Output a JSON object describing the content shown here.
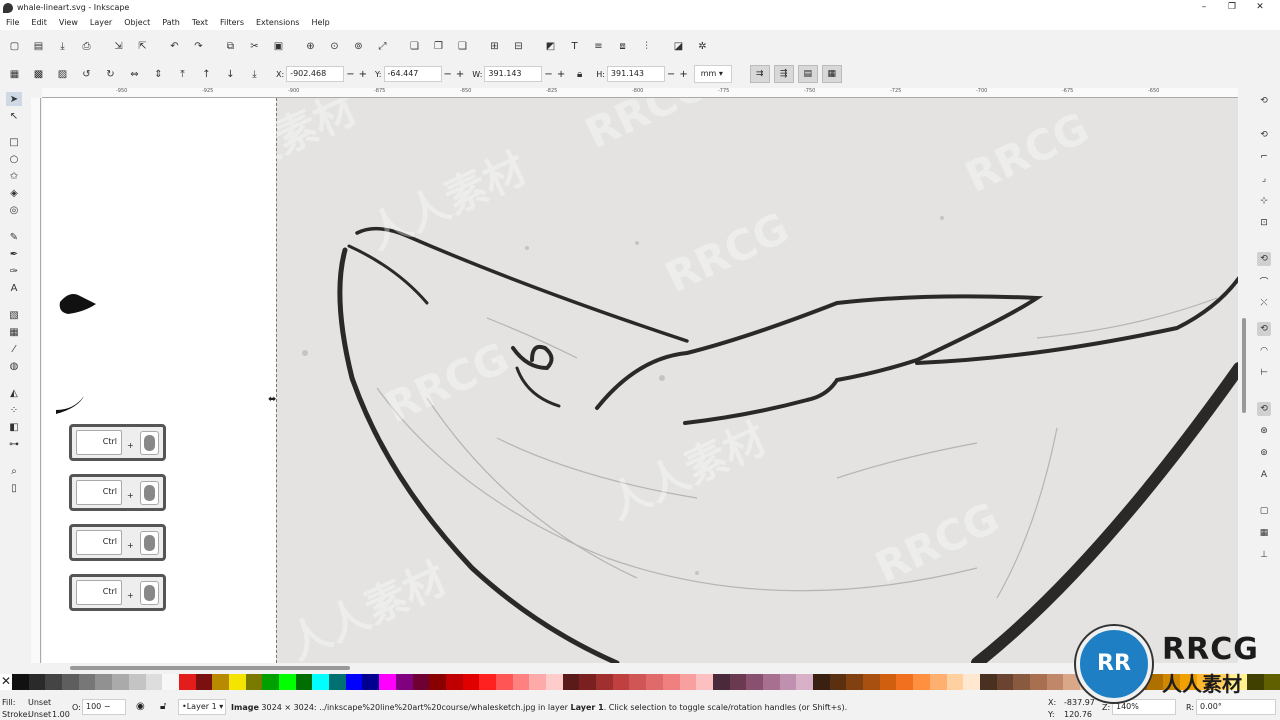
{
  "window": {
    "title": "whale-lineart.svg - Inkscape",
    "min": "–",
    "max": "❐",
    "close": "✕"
  },
  "menu": [
    "File",
    "Edit",
    "View",
    "Layer",
    "Object",
    "Path",
    "Text",
    "Filters",
    "Extensions",
    "Help"
  ],
  "toolbar": {
    "x_label": "X:",
    "x_value": "-902.468",
    "y_label": "Y:",
    "y_value": "-64.447",
    "w_label": "W:",
    "w_value": "391.143",
    "h_label": "H:",
    "h_value": "391.143",
    "unit": "mm"
  },
  "rulers": {
    "top": [
      "-950",
      "-925",
      "-900",
      "-875",
      "-850",
      "-825",
      "-800",
      "-775",
      "-750",
      "-725",
      "-700",
      "-675",
      "-650"
    ]
  },
  "key_hints": [
    {
      "key": "Ctrl",
      "plus": "+"
    },
    {
      "key": "Ctrl",
      "plus": "+"
    },
    {
      "key": "Ctrl",
      "plus": "+"
    },
    {
      "key": "Ctrl",
      "plus": "+"
    }
  ],
  "palette": [
    "#111111",
    "#2a2a2a",
    "#444444",
    "#5e5e5e",
    "#777777",
    "#919191",
    "#aaaaaa",
    "#c4c4c4",
    "#dddddd",
    "#f7f7f7",
    "#e31c1c",
    "#7a1010",
    "#b88a00",
    "#f5e400",
    "#7a7a00",
    "#00a000",
    "#00ff00",
    "#006e00",
    "#00ffff",
    "#007070",
    "#0000ff",
    "#000090",
    "#ff00ff",
    "#800080",
    "#6e0033",
    "#8a0000",
    "#c00000",
    "#e00000",
    "#ff2020",
    "#ff5555",
    "#ff8080",
    "#ffaaaa",
    "#ffcccc",
    "#5a1a1a",
    "#7a2020",
    "#a03030",
    "#c04040",
    "#d05555",
    "#e06a6a",
    "#f08080",
    "#f8a0a0",
    "#fcc0c0",
    "#4a2a3a",
    "#6a3a50",
    "#8a5070",
    "#a87090",
    "#c090b0",
    "#d8b0c8",
    "#3a2010",
    "#5a3010",
    "#804010",
    "#a85010",
    "#d06010",
    "#f07020",
    "#ff9040",
    "#ffb070",
    "#ffd0a0",
    "#ffe8d0",
    "#4a3020",
    "#6a4430",
    "#8a5a40",
    "#a87050",
    "#c08868",
    "#d8a888",
    "#f0c8a8",
    "#503000",
    "#704400",
    "#905800",
    "#b07000",
    "#d08800",
    "#f0a000",
    "#ffb830",
    "#ffd060",
    "#fff090",
    "#404000",
    "#606000"
  ],
  "status": {
    "fill_label": "Fill:",
    "fill_value": "Unset",
    "stroke_label": "Stroke:",
    "stroke_value": "Unset",
    "stroke_width": "1.00",
    "opacity_label": "O:",
    "opacity_value": "100",
    "layer": "•Layer 1",
    "message_bold": "Image",
    "message": " 3024 × 3024: ../inkscape%20line%20art%20course/whalesketch.jpg in layer ",
    "message_layer": "Layer 1",
    "message_tail": ". Click selection to toggle scale/rotation handles (or Shift+s).",
    "x_label": "X:",
    "x_value": "-837.97",
    "y_label": "Y:",
    "y_value": "120.76",
    "zoom_label": "Z:",
    "zoom_value": "140%",
    "rot_label": "R:",
    "rot_value": "0.00°"
  },
  "watermark": {
    "text_latin": "RRCG",
    "text_cn": "人人素材"
  },
  "logo": {
    "mark": "RR",
    "brand": "RRCG",
    "cn": "人人素材"
  }
}
